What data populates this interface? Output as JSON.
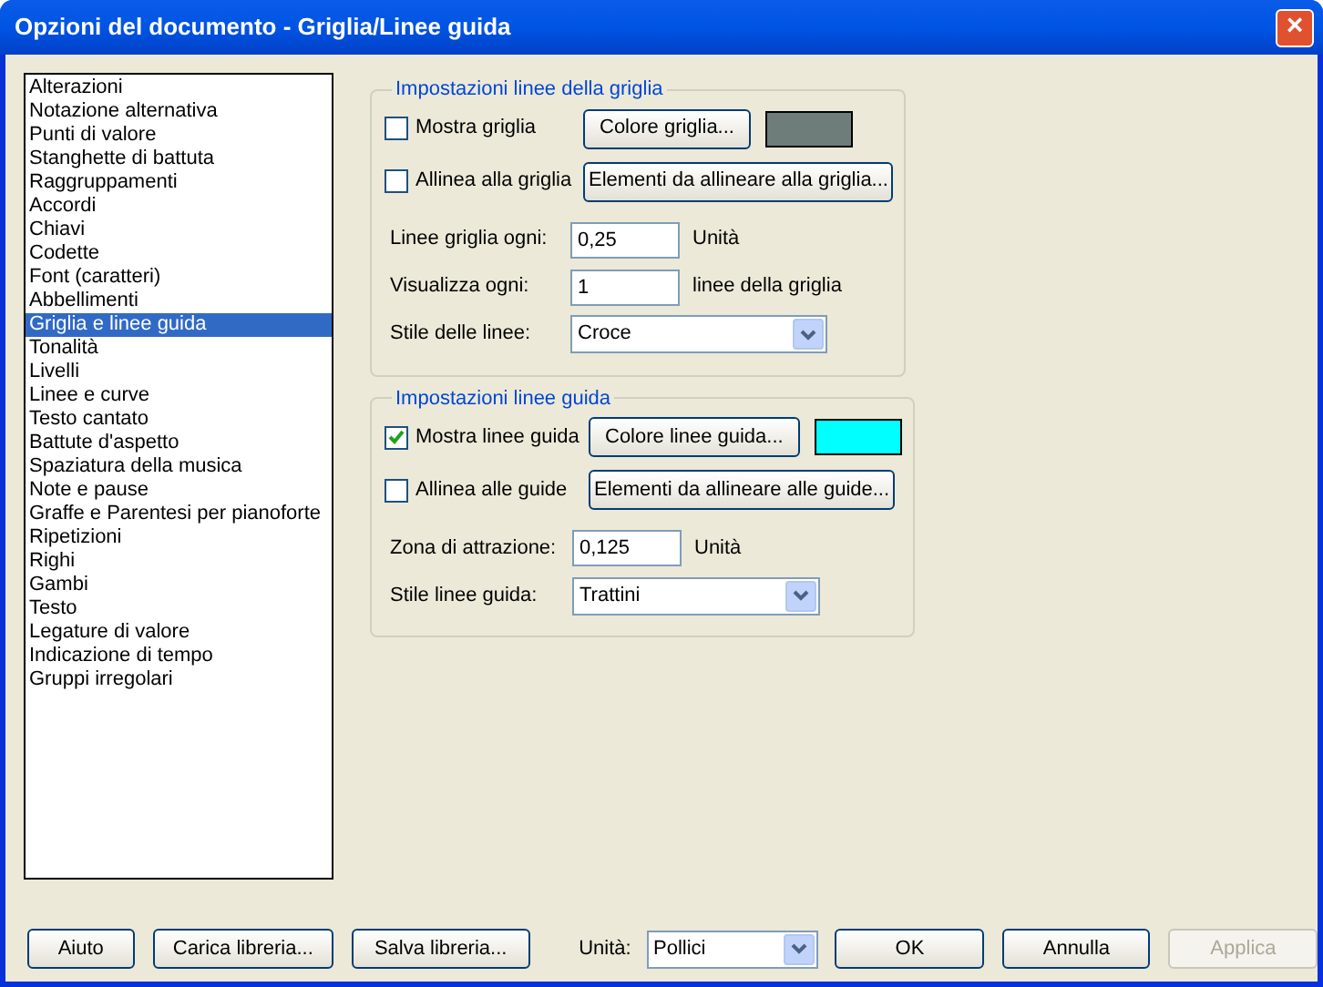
{
  "window": {
    "title": "Opzioni del documento - Griglia/Linee guida",
    "close": "×"
  },
  "sidebar": {
    "items": [
      {
        "label": "Alterazioni",
        "selected": false
      },
      {
        "label": "Notazione alternativa",
        "selected": false
      },
      {
        "label": "Punti di valore",
        "selected": false
      },
      {
        "label": "Stanghette di battuta",
        "selected": false
      },
      {
        "label": "Raggruppamenti",
        "selected": false
      },
      {
        "label": "Accordi",
        "selected": false
      },
      {
        "label": "Chiavi",
        "selected": false
      },
      {
        "label": "Codette",
        "selected": false
      },
      {
        "label": "Font (caratteri)",
        "selected": false
      },
      {
        "label": "Abbellimenti",
        "selected": false
      },
      {
        "label": "Griglia e linee guida",
        "selected": true
      },
      {
        "label": "Tonalità",
        "selected": false
      },
      {
        "label": "Livelli",
        "selected": false
      },
      {
        "label": "Linee e curve",
        "selected": false
      },
      {
        "label": "Testo cantato",
        "selected": false
      },
      {
        "label": "Battute d'aspetto",
        "selected": false
      },
      {
        "label": "Spaziatura della musica",
        "selected": false
      },
      {
        "label": "Note e pause",
        "selected": false
      },
      {
        "label": "Graffe e Parentesi per pianoforte",
        "selected": false
      },
      {
        "label": "Ripetizioni",
        "selected": false
      },
      {
        "label": "Righi",
        "selected": false
      },
      {
        "label": "Gambi",
        "selected": false
      },
      {
        "label": "Testo",
        "selected": false
      },
      {
        "label": "Legature di valore",
        "selected": false
      },
      {
        "label": "Indicazione di tempo",
        "selected": false
      },
      {
        "label": "Gruppi irregolari",
        "selected": false
      }
    ]
  },
  "groups": [
    {
      "title": "Impostazioni linee della griglia",
      "color": "#6e7d7a",
      "show": {
        "label": "Mostra griglia",
        "checked": false
      },
      "color_button": "Colore griglia...",
      "align": {
        "label": "Allinea alla griglia",
        "checked": false
      },
      "align_button": "Elementi da allineare alla griglia...",
      "fields": [
        {
          "kind": "input",
          "label": "Linee griglia ogni:",
          "value": "0,25",
          "unit": "Unità"
        },
        {
          "kind": "input",
          "label": "Visualizza ogni:",
          "value": "1",
          "unit": "linee della griglia"
        },
        {
          "kind": "select",
          "label": "Stile delle linee:",
          "value": "Croce"
        }
      ]
    },
    {
      "title": "Impostazioni linee guida",
      "color": "#00ffff",
      "show": {
        "label": "Mostra linee guida",
        "checked": true
      },
      "color_button": "Colore linee guida...",
      "align": {
        "label": "Allinea alle guide",
        "checked": false
      },
      "align_button": "Elementi da allineare alle guide...",
      "fields": [
        {
          "kind": "input",
          "label": "Zona di attrazione:",
          "value": "0,125",
          "unit": "Unità"
        },
        {
          "kind": "select",
          "label": "Stile linee guida:",
          "value": "Trattini"
        }
      ]
    }
  ],
  "footer": {
    "help": "Aiuto",
    "load": "Carica libreria...",
    "save": "Salva libreria...",
    "units_label": "Unità:",
    "units": "Pollici",
    "buttons": [
      {
        "label": "OK",
        "disabled": false
      },
      {
        "label": "Annulla",
        "disabled": false
      },
      {
        "label": "Applica",
        "disabled": true
      }
    ]
  }
}
